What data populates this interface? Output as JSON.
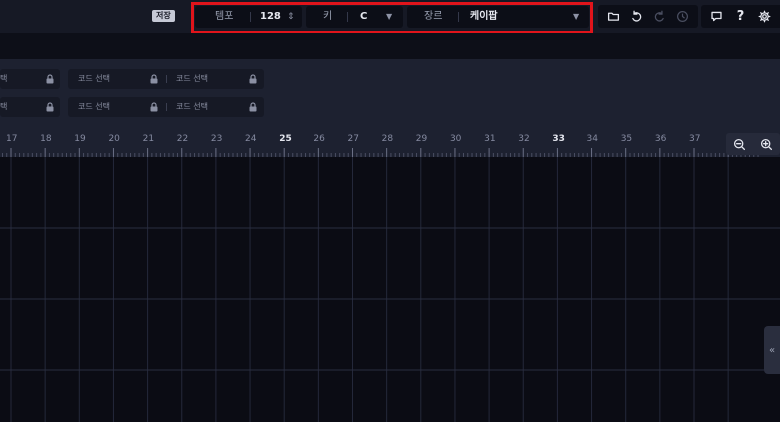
{
  "topbar": {
    "save_label": "저장",
    "tempo": {
      "label": "템포",
      "value": "128",
      "stepper": "⇕"
    },
    "key": {
      "label": "키",
      "value": "C",
      "caret": "▼"
    },
    "genre": {
      "label": "장르",
      "value": "케이팝",
      "caret": "▼"
    },
    "tools": {
      "icons": [
        "folder-icon",
        "undo-icon",
        "redo-icon",
        "history-icon",
        "comment-icon",
        "help-icon",
        "gear-icon"
      ],
      "help_glyph": "?"
    }
  },
  "chords": {
    "placeholder": "코드 선택",
    "cut_placeholder": "택"
  },
  "ruler": {
    "bars": [
      "17",
      "18",
      "19",
      "20",
      "21",
      "22",
      "23",
      "24",
      "25",
      "26",
      "27",
      "28",
      "29",
      "30",
      "31",
      "32",
      "33",
      "34",
      "35",
      "36",
      "37"
    ],
    "major_bars": [
      "25",
      "33"
    ]
  },
  "side_tab": {
    "glyph": "«"
  },
  "colors": {
    "highlight": "#e0141b",
    "background": "#0b0c14",
    "panel": "#1d2130",
    "toolbar": "#161925"
  }
}
